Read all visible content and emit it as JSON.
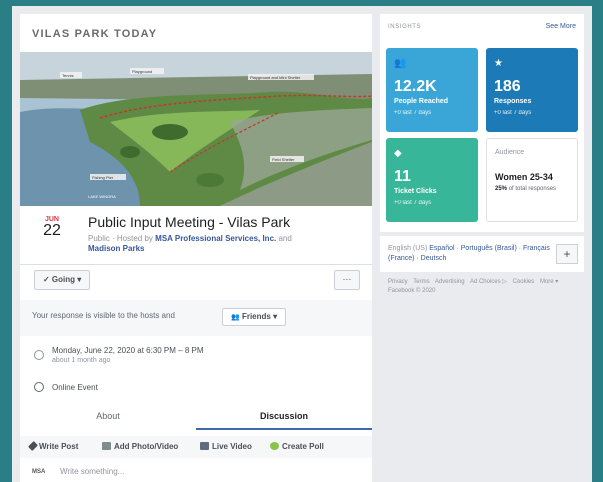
{
  "event": {
    "header_title": "VILAS PARK TODAY",
    "photo_labels": {
      "top_left": "Tennis",
      "top_mid": "Playground",
      "top_right": "Playground and Mini Shelter",
      "fishing_pier": "Fishing Pier",
      "lake": "LAKE WINGRA",
      "field": "Field Shelter"
    },
    "date_month": "JUN",
    "date_day": "22",
    "title": "Public Input Meeting - Vilas Park",
    "hosts_prefix": "Public · Hosted by",
    "host_1": "MSA Professional Services, Inc.",
    "hosts_and": "and",
    "host_2": "Madison Parks",
    "going_label": "✓ Going ▾",
    "more_label": "···",
    "response_text": "Your response is visible to the hosts and",
    "friends_label": "Friends ▾",
    "time_main": "Monday, June 22, 2020 at 6:30 PM – 8 PM",
    "time_sub": "about 1 month ago",
    "online_label": "Online Event",
    "tab_about": "About",
    "tab_discussion": "Discussion",
    "composer": {
      "write_post": "Write Post",
      "add_photo": "Add Photo/Video",
      "live_video": "Live Video",
      "create_poll": "Create Poll"
    },
    "msa_logo": "MSA",
    "write_placeholder": "Write something..."
  },
  "insights": {
    "title": "INSIGHTS",
    "see_more": "See More",
    "reach": {
      "value": "12.2K",
      "label": "People Reached",
      "sub": "+0 last 7 days"
    },
    "responses": {
      "value": "186",
      "label": "Responses",
      "sub": "+0 last 7 days"
    },
    "tickets": {
      "value": "11",
      "label": "Ticket Clicks",
      "sub": "+0 last 7 days"
    },
    "audience": {
      "label": "Audience",
      "value": "Women 25-34",
      "sub_pct": "25%",
      "sub_text": "of total responses"
    }
  },
  "languages": {
    "current": "English (US)",
    "others": "Español · Português (Brasil) · Français (France) · Deutsch",
    "add": "+"
  },
  "footer": {
    "links": [
      "Privacy",
      "Terms",
      "Advertising",
      "Ad Choices ▷",
      "Cookies",
      "More ▾"
    ],
    "copyright": "Facebook © 2020"
  },
  "colors": {
    "accent": "#4267b2",
    "reach_card": "#3aa6d8",
    "responses_card": "#1c7ab7",
    "tickets_card": "#38b69a",
    "outer_border": "#2a7f86"
  },
  "icons": [
    "people-icon",
    "star-icon",
    "ticket-icon",
    "clock-icon",
    "globe-icon",
    "pencil-icon",
    "photo-icon",
    "video-icon",
    "poll-icon"
  ]
}
